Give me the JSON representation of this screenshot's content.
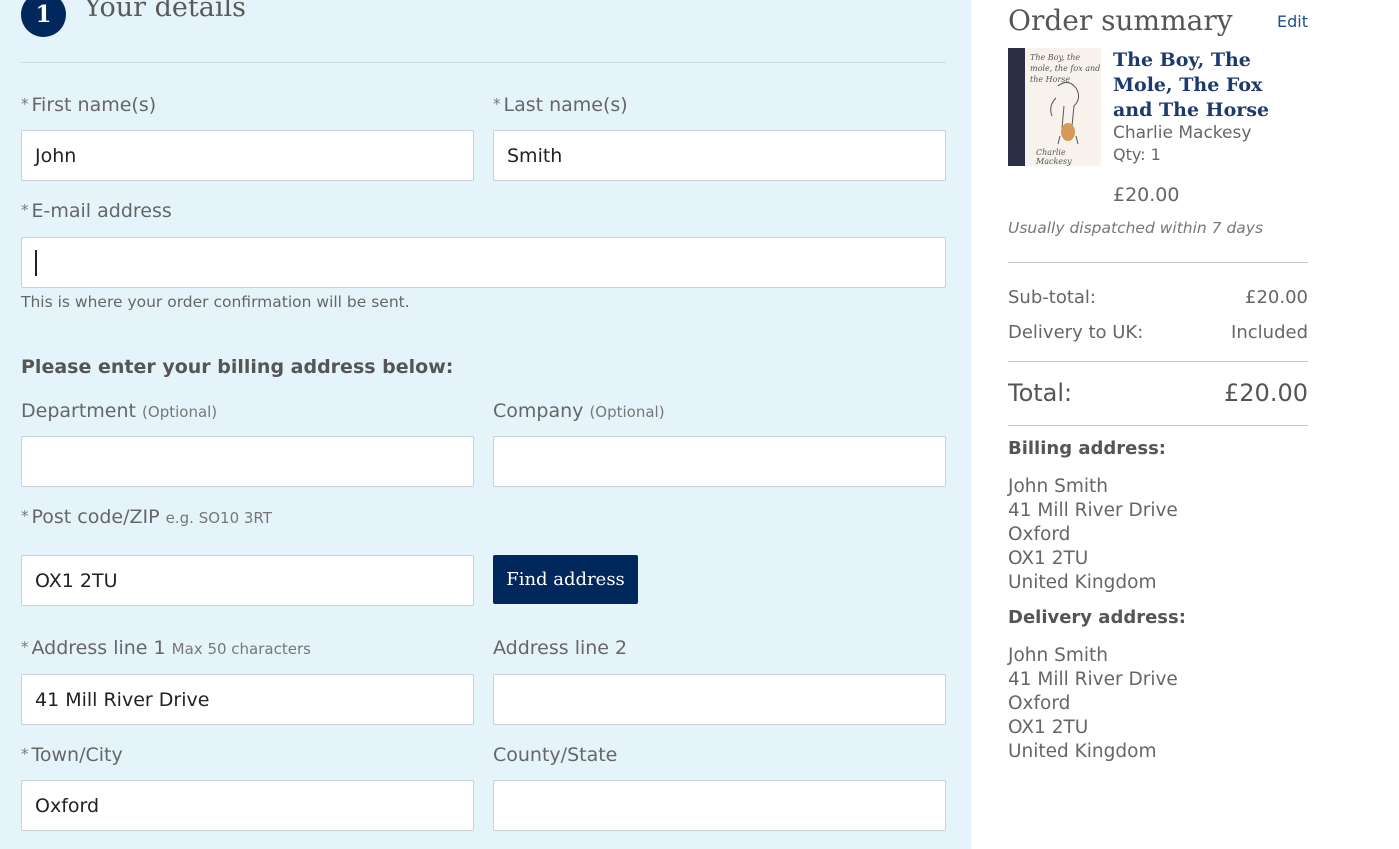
{
  "form": {
    "step_number": "1",
    "step_title": "Your details",
    "required_marker": "*",
    "first_name": {
      "label": "First name(s)",
      "value": "John"
    },
    "last_name": {
      "label": "Last name(s)",
      "value": "Smith"
    },
    "email": {
      "label": "E-mail address",
      "value": "",
      "helper": "This is where your order confirmation will be sent."
    },
    "billing_heading": "Please enter your billing address below:",
    "department": {
      "label": "Department",
      "hint": "(Optional)",
      "value": ""
    },
    "company": {
      "label": "Company",
      "hint": "(Optional)",
      "value": ""
    },
    "postcode": {
      "label": "Post code/ZIP",
      "hint": "e.g. SO10 3RT",
      "value": "OX1 2TU"
    },
    "find_address_label": "Find address",
    "address1": {
      "label": "Address line 1",
      "hint": "Max 50 characters",
      "value": "41 Mill River Drive"
    },
    "address2": {
      "label": "Address line 2",
      "value": ""
    },
    "town": {
      "label": "Town/City",
      "value": "Oxford"
    },
    "county": {
      "label": "County/State",
      "value": ""
    }
  },
  "summary": {
    "title": "Order summary",
    "edit_label": "Edit",
    "item": {
      "title": "The Boy, The Mole, The Fox and The Horse",
      "author": "Charlie Mackesy",
      "qty": "Qty: 1",
      "price": "£20.00",
      "cover_text": "The Boy, the mole, the fox and the Horse",
      "cover_signature": "Charlie Mackesy"
    },
    "dispatch": "Usually dispatched within 7 days",
    "subtotal_label": "Sub-total:",
    "subtotal_value": "£20.00",
    "delivery_label": "Delivery to UK:",
    "delivery_value": "Included",
    "total_label": "Total:",
    "total_value": "£20.00",
    "billing": {
      "heading": "Billing address:",
      "lines": [
        "John Smith",
        "41 Mill River Drive",
        "Oxford",
        "OX1 2TU",
        "United Kingdom"
      ]
    },
    "delivery": {
      "heading": "Delivery address:",
      "lines": [
        "John Smith",
        "41 Mill River Drive",
        "Oxford",
        "OX1 2TU",
        "United Kingdom"
      ]
    }
  },
  "colors": {
    "panel_bg": "#e5f4fb",
    "primary": "#00285c",
    "link": "#1f4f8e"
  }
}
